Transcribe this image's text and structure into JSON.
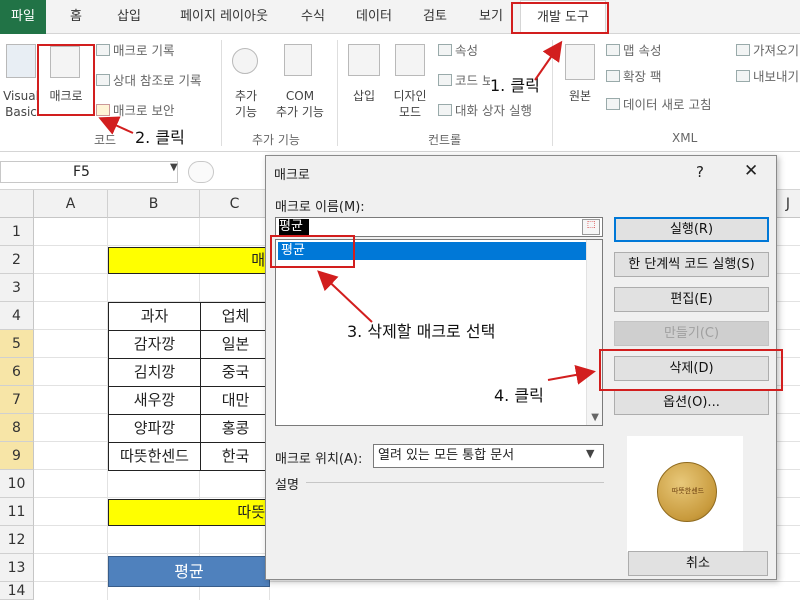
{
  "ribbon_tabs": [
    {
      "label": "파일"
    },
    {
      "label": "홈"
    },
    {
      "label": "삽입"
    },
    {
      "label": "페이지 레이아웃"
    },
    {
      "label": "수식"
    },
    {
      "label": "데이터"
    },
    {
      "label": "검토"
    },
    {
      "label": "보기"
    },
    {
      "label": "개발 도구"
    }
  ],
  "ribbon": {
    "visual_basic": "Visual\nBasic",
    "macro": "매크로",
    "record_macro": "매크로 기록",
    "relative_ref": "상대 참조로 기록",
    "macro_security": "매크로 보안",
    "code_group": "코드",
    "addins": "추가\n기능",
    "com_addins": "COM\n추가 기능",
    "addins_group": "추가 기능",
    "insert": "삽입",
    "design_mode": "디자인\n모드",
    "properties": "속성",
    "view_code": "코드 보기",
    "run_dialog": "대화 상자 실행",
    "controls_group": "컨트롤",
    "source": "원본",
    "map_props": "맵 속성",
    "expansion_pack": "확장 팩",
    "refresh_data": "데이터 새로 고침",
    "import": "가져오기",
    "export": "내보내기",
    "xml_group": "XML"
  },
  "formula_bar": {
    "name_box": "F5"
  },
  "columns": [
    "A",
    "B",
    "C",
    "J"
  ],
  "rows": [
    "1",
    "2",
    "3",
    "4",
    "5",
    "6",
    "7",
    "8",
    "9",
    "10",
    "11",
    "12",
    "13",
    "14"
  ],
  "sheet": {
    "row2_fragment": "매",
    "header_b": "과자",
    "header_c": "업체",
    "items": [
      {
        "b": "감자깡",
        "c": "일본"
      },
      {
        "b": "김치깡",
        "c": "중국"
      },
      {
        "b": "새우깡",
        "c": "대만"
      },
      {
        "b": "양파깡",
        "c": "홍콩"
      },
      {
        "b": "따뜻한센드",
        "c": "한국"
      }
    ],
    "row11_fragment": "따뜻",
    "button13": "평균"
  },
  "dialog": {
    "title": "매크로",
    "help": "?",
    "close": "✕",
    "name_label": "매크로 이름(M):",
    "name_value": "평균",
    "list_item": "평균",
    "location_label": "매크로 위치(A):",
    "location_value": "열려 있는 모든 통합 문서",
    "desc_label": "설명",
    "buttons": {
      "run": "실행(R)",
      "step": "한 단계씩 코드 실행(S)",
      "edit": "편집(E)",
      "create": "만들기(C)",
      "delete": "삭제(D)",
      "options": "옵션(O)...",
      "cancel": "취소"
    },
    "coin_text": "따뜻한센드"
  },
  "annotations": {
    "step1": "1. 클릭",
    "step2": "2. 클릭",
    "step3": "3. 삭제할 매크로 선택",
    "step4": "4. 클릭"
  },
  "colors": {
    "annotation_red": "#d21e1e",
    "excel_green": "#217346",
    "selection_blue": "#0078d7",
    "highlight_yellow": "#ffff00"
  }
}
